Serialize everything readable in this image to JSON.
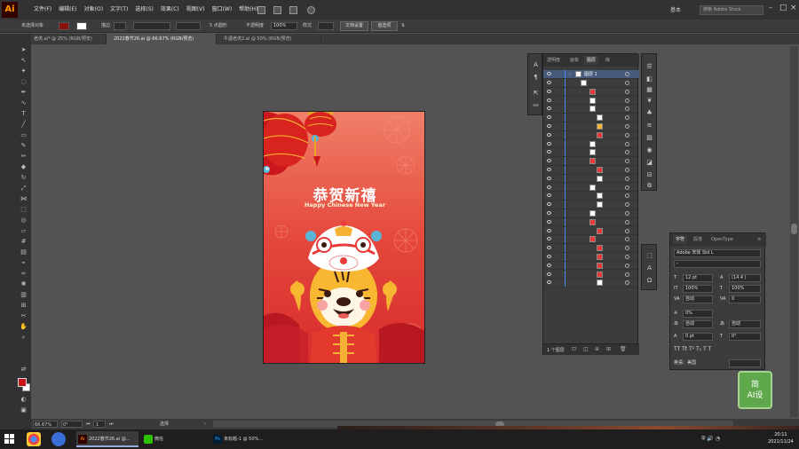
{
  "app": {
    "logo": "Ai"
  },
  "menubar": {
    "items": [
      "文件(F)",
      "编辑(E)",
      "对象(O)",
      "文字(T)",
      "选择(S)",
      "效果(C)",
      "视图(V)",
      "窗口(W)",
      "帮助(H)"
    ],
    "workspace": "基本",
    "stock_search": "搜索 Adobe Stock"
  },
  "control_bar": {
    "selection": "未选择对象",
    "stroke_label": "描边",
    "brush": "5 点圆形",
    "opacity_label": "不透明度",
    "opacity": "100%",
    "style_label": "样式",
    "doc_setup": "文档设置",
    "preferences": "首选项"
  },
  "tabs": [
    {
      "label": "老虎.ai* @ 25% (RGB/预览)",
      "active": false
    },
    {
      "label": "2022春节26.ai @ 66.67% (RGB/预览)",
      "active": true
    },
    {
      "label": "牛遇老虎2.ai @ 50% (RGB/预览)",
      "active": false
    }
  ],
  "artwork": {
    "title": "恭贺新禧",
    "subtitle": "Happy Chinese New Year"
  },
  "layers_panel": {
    "tabs": [
      "透明度",
      "画板",
      "图层",
      "库"
    ],
    "active_tab": "图层",
    "top_layer": "图层 1",
    "footer": "1 个图层"
  },
  "character_panel": {
    "tabs": [
      "字符",
      "段落",
      "OpenType"
    ],
    "font": "Adobe 宋体 Std L",
    "style": "-",
    "size": "12 pt",
    "leading": "(14.4 )",
    "vscale": "100%",
    "hscale": "100%",
    "kerning": "自动",
    "tracking": "0",
    "tsume": "0%",
    "aki_left": "自动",
    "aki_right": "自动",
    "baseline": "0 pt",
    "rotation": "0°",
    "language": "英语：美国"
  },
  "status_bar": {
    "zoom": "66.67%",
    "rotation": "0°",
    "page": "1",
    "tool": "选择"
  },
  "watermark": "简\nAI设",
  "taskbar": {
    "apps": [
      "2022春节26.ai @...",
      "微信",
      "未标题-1 @ 50%..."
    ],
    "time": "20:11",
    "date": "2021/11/24"
  },
  "colors": {
    "fill": "#c4151c",
    "accent": "#4c86ff"
  }
}
